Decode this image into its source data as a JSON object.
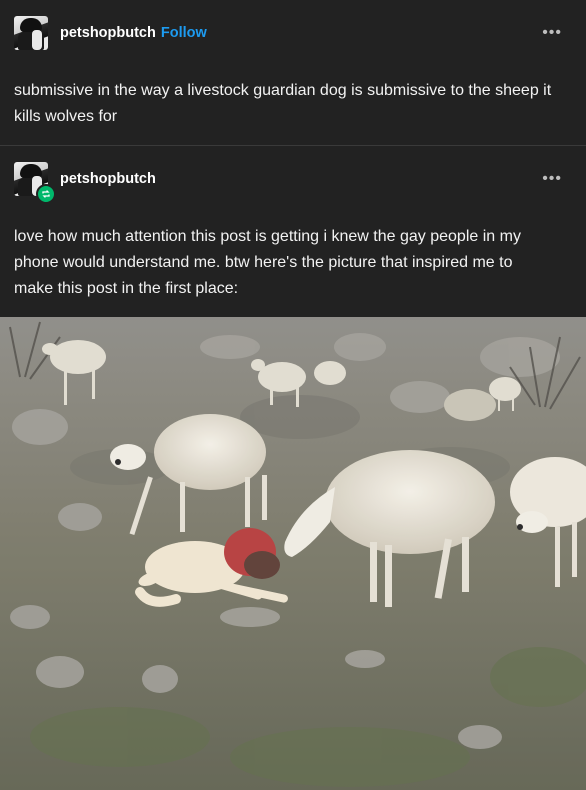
{
  "original_post": {
    "username": "petshopbutch",
    "follow_label": "Follow",
    "more_label": "•••",
    "text": "submissive in the way a livestock guardian dog is submissive to the sheep it kills wolves for"
  },
  "reblog": {
    "username": "petshopbutch",
    "more_label": "•••",
    "text": "love how much attention this post is getting i knew the gay people in my phone would understand me. btw here's the picture that inspired me to make this post in the first place:"
  },
  "colors": {
    "background": "#222222",
    "link": "#1d9bf0",
    "reblog_badge": "#00b86b"
  },
  "icons": {
    "avatar": "avatar-image",
    "reblog": "reblog-icon",
    "more": "more-options-icon"
  }
}
